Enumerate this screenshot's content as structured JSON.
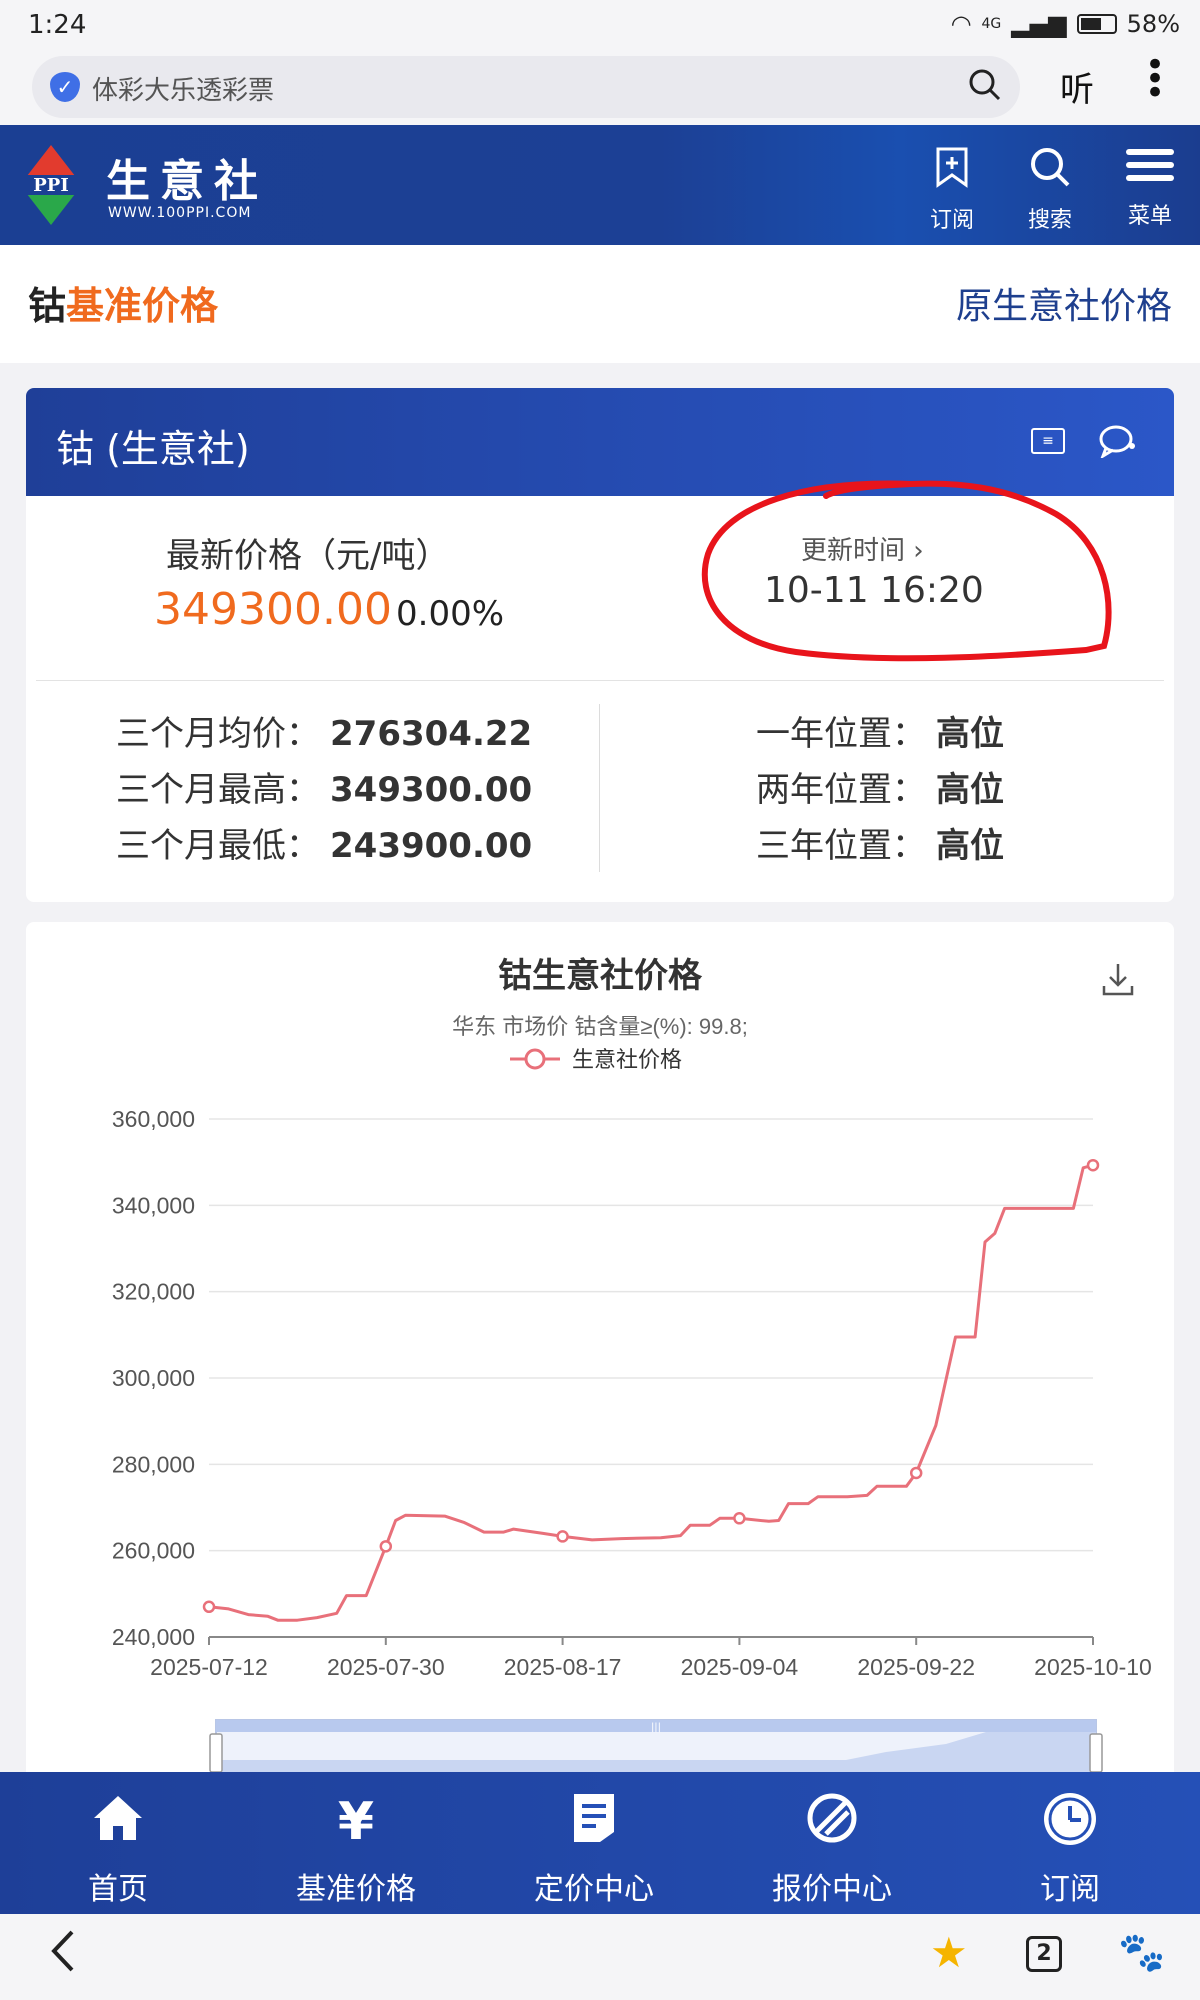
{
  "status": {
    "time": "1:24",
    "battery": "58%",
    "network": "4G"
  },
  "browser": {
    "url_text": "体彩大乐透彩票",
    "listen_label": "听"
  },
  "site": {
    "name": "生意社",
    "url": "WWW.100PPI.COM",
    "logo_text": "PPI",
    "header_buttons": [
      {
        "label": "订阅",
        "icon": "subscribe-icon"
      },
      {
        "label": "搜索",
        "icon": "search-icon"
      },
      {
        "label": "菜单",
        "icon": "menu-icon"
      }
    ]
  },
  "page": {
    "title_prefix": "钴",
    "title_highlight": "基准价格",
    "original_link": "原生意社价格"
  },
  "card": {
    "title": "钴 (生意社)",
    "price_label": "最新价格（元/吨）",
    "price_value": "349300.00",
    "price_change": "0.00%",
    "update_label": "更新时间",
    "update_chevron": "›",
    "update_time": "10-11 16:20",
    "stats_left": [
      {
        "label": "三个月均价：",
        "value": "276304.22"
      },
      {
        "label": "三个月最高：",
        "value": "349300.00"
      },
      {
        "label": "三个月最低：",
        "value": "243900.00"
      }
    ],
    "stats_right": [
      {
        "label": "一年位置：",
        "value": "高位"
      },
      {
        "label": "两年位置：",
        "value": "高位"
      },
      {
        "label": "三年位置：",
        "value": "高位"
      }
    ]
  },
  "chart_data": {
    "type": "line",
    "title": "钴生意社价格",
    "subtitle": "华东 市场价 钴含量≥(%): 99.8;",
    "legend": [
      "生意社价格"
    ],
    "legend_position": "top-center",
    "ylim": [
      240000,
      360000
    ],
    "yticks": [
      "240,000",
      "260,000",
      "280,000",
      "300,000",
      "320,000",
      "340,000",
      "360,000"
    ],
    "xticks": [
      "2025-07-12",
      "2025-07-30",
      "2025-08-17",
      "2025-09-04",
      "2025-09-22",
      "2025-10-10"
    ],
    "x_start": "2025-07-12",
    "x_end": "2025-10-10",
    "grid": true,
    "series_color": "#e8707a",
    "series": [
      {
        "name": "生意社价格",
        "points": [
          [
            "2025-07-12",
            247000
          ],
          [
            "2025-07-14",
            246500
          ],
          [
            "2025-07-16",
            245200
          ],
          [
            "2025-07-18",
            244800
          ],
          [
            "2025-07-19",
            243900
          ],
          [
            "2025-07-21",
            243900
          ],
          [
            "2025-07-23",
            244500
          ],
          [
            "2025-07-25",
            245500
          ],
          [
            "2025-07-26",
            249600
          ],
          [
            "2025-07-28",
            249600
          ],
          [
            "2025-07-30",
            261000
          ],
          [
            "2025-07-31",
            267000
          ],
          [
            "2025-08-01",
            268200
          ],
          [
            "2025-08-05",
            268000
          ],
          [
            "2025-08-07",
            266500
          ],
          [
            "2025-08-09",
            264300
          ],
          [
            "2025-08-11",
            264300
          ],
          [
            "2025-08-12",
            265000
          ],
          [
            "2025-08-15",
            264000
          ],
          [
            "2025-08-17",
            263300
          ],
          [
            "2025-08-20",
            262500
          ],
          [
            "2025-08-23",
            262800
          ],
          [
            "2025-08-27",
            263000
          ],
          [
            "2025-08-29",
            263500
          ],
          [
            "2025-08-30",
            265900
          ],
          [
            "2025-09-01",
            265900
          ],
          [
            "2025-09-02",
            267500
          ],
          [
            "2025-09-04",
            267500
          ],
          [
            "2025-09-07",
            266800
          ],
          [
            "2025-09-08",
            267000
          ],
          [
            "2025-09-09",
            270900
          ],
          [
            "2025-09-11",
            270900
          ],
          [
            "2025-09-12",
            272500
          ],
          [
            "2025-09-15",
            272500
          ],
          [
            "2025-09-17",
            272800
          ],
          [
            "2025-09-18",
            274900
          ],
          [
            "2025-09-21",
            274900
          ],
          [
            "2025-09-22",
            278000
          ],
          [
            "2025-09-24",
            289000
          ],
          [
            "2025-09-26",
            309500
          ],
          [
            "2025-09-28",
            309500
          ],
          [
            "2025-09-29",
            331500
          ],
          [
            "2025-09-30",
            333500
          ],
          [
            "2025-10-01",
            339300
          ],
          [
            "2025-10-08",
            339300
          ],
          [
            "2025-10-09",
            348700
          ],
          [
            "2025-10-10",
            349300
          ]
        ],
        "markers": [
          "2025-07-12",
          "2025-07-30",
          "2025-08-17",
          "2025-09-04",
          "2025-09-22",
          "2025-10-10"
        ]
      }
    ]
  },
  "bottom_nav": [
    {
      "label": "首页",
      "icon": "home-icon"
    },
    {
      "label": "基准价格",
      "icon": "yen-icon"
    },
    {
      "label": "定价中心",
      "icon": "document-icon"
    },
    {
      "label": "报价中心",
      "icon": "quote-icon"
    },
    {
      "label": "订阅",
      "icon": "clock-icon"
    }
  ],
  "browser_bottom": {
    "tab_count": "2"
  }
}
